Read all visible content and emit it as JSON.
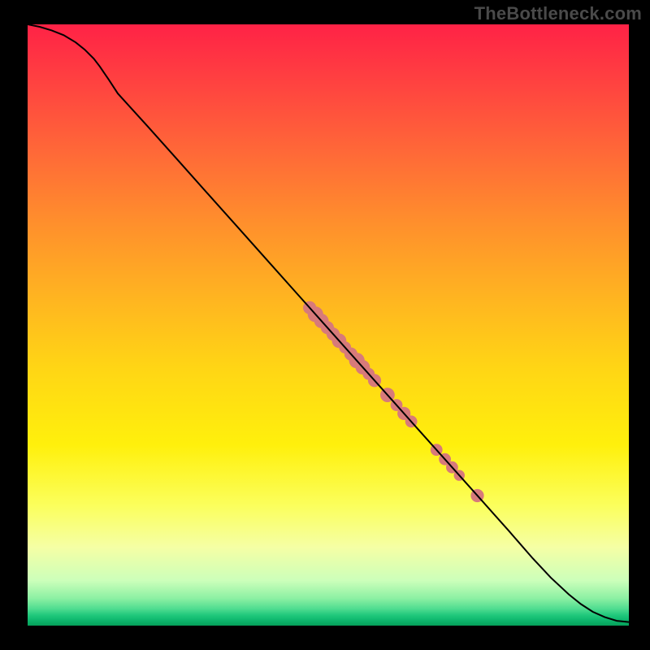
{
  "watermark": "TheBottleneck.com",
  "chart_data": {
    "type": "line",
    "title": "",
    "xlabel": "",
    "ylabel": "",
    "xlim": [
      0,
      100
    ],
    "ylim": [
      0,
      100
    ],
    "curve_xy": [
      [
        0,
        100
      ],
      [
        2,
        99.6
      ],
      [
        4,
        99.0
      ],
      [
        6,
        98.2
      ],
      [
        8,
        97.0
      ],
      [
        9.5,
        95.8
      ],
      [
        11,
        94.3
      ],
      [
        12,
        93.0
      ],
      [
        13.5,
        90.8
      ],
      [
        15,
        88.5
      ],
      [
        20,
        83.0
      ],
      [
        25,
        77.4
      ],
      [
        30,
        71.8
      ],
      [
        35,
        66.2
      ],
      [
        40,
        60.6
      ],
      [
        45,
        55.0
      ],
      [
        50,
        49.4
      ],
      [
        55,
        43.8
      ],
      [
        60,
        38.2
      ],
      [
        65,
        32.6
      ],
      [
        70,
        27.0
      ],
      [
        75,
        21.4
      ],
      [
        80,
        15.8
      ],
      [
        84,
        11.2
      ],
      [
        87,
        8.0
      ],
      [
        90,
        5.2
      ],
      [
        92,
        3.6
      ],
      [
        94,
        2.3
      ],
      [
        96,
        1.4
      ],
      [
        98,
        0.8
      ],
      [
        100,
        0.6
      ]
    ],
    "highlight_clusters": [
      {
        "center_x": 50.5,
        "center_y": 48.8,
        "radii": [
          0.9
        ]
      },
      {
        "center_x": 52.3,
        "center_y": 46.7,
        "radii": [
          1.1,
          1.3,
          1.2,
          1.1,
          1.1,
          1.2,
          1.0,
          1.1,
          1.3,
          1.2,
          1.0,
          1.1
        ],
        "span": 10.8
      },
      {
        "center_x": 60.6,
        "center_y": 37.5,
        "radii": [
          1.2,
          1.0
        ],
        "span": 1.5
      },
      {
        "center_x": 63.2,
        "center_y": 34.6,
        "radii": [
          1.1,
          1.0
        ],
        "span": 1.2
      },
      {
        "center_x": 68.0,
        "center_y": 29.2,
        "radii": [
          1.0
        ]
      },
      {
        "center_x": 70.0,
        "center_y": 27.0,
        "radii": [
          1.0,
          1.0
        ],
        "span": 1.2
      },
      {
        "center_x": 71.8,
        "center_y": 25.0,
        "radii": [
          0.9
        ]
      },
      {
        "center_x": 74.8,
        "center_y": 21.6,
        "radii": [
          1.1
        ]
      }
    ],
    "colors": {
      "line": "#000000",
      "marker": "#d77a7a"
    }
  }
}
